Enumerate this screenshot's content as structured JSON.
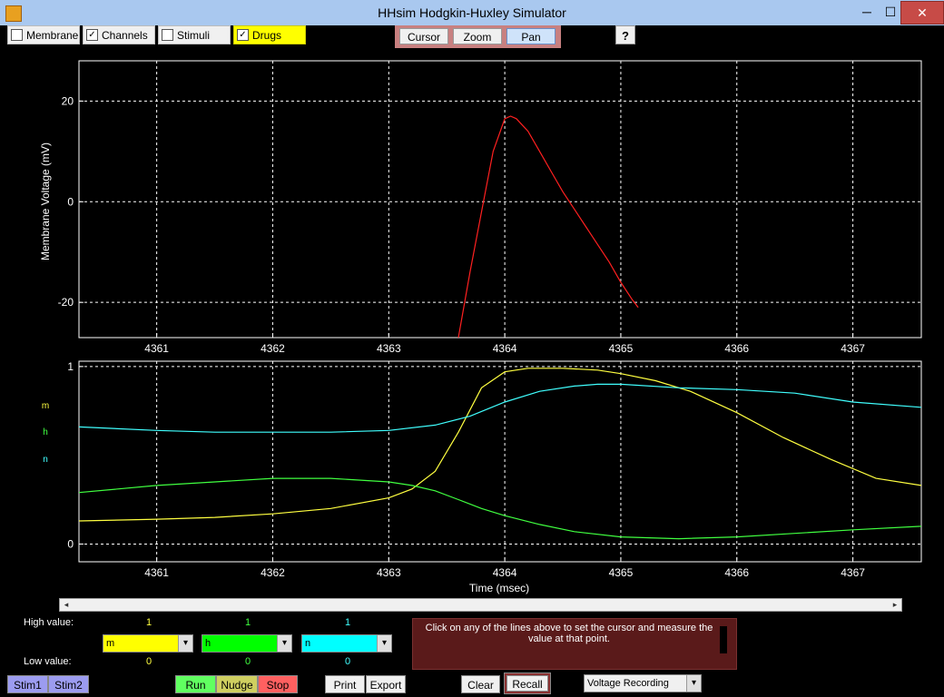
{
  "window": {
    "title": "HHsim Hodgkin-Huxley Simulator",
    "min": "─",
    "max": "☐",
    "close": "✕"
  },
  "toolbar": {
    "checkboxes": [
      {
        "label": "Membrane",
        "checked": false
      },
      {
        "label": "Channels",
        "checked": true
      },
      {
        "label": "Stimuli",
        "checked": false
      },
      {
        "label": "Drugs",
        "checked": true
      }
    ],
    "check_mark": "✓",
    "tools": [
      "Cursor",
      "Zoom",
      "Pan"
    ],
    "help": "?"
  },
  "top_plot": {
    "ylabel": "Membrane Voltage (mV)",
    "yticks": [
      "20",
      "0",
      "-20"
    ],
    "xticks": [
      "4361",
      "4362",
      "4363",
      "4364",
      "4365",
      "4366",
      "4367"
    ],
    "trace_color": "#ff2020"
  },
  "bottom_plot": {
    "xlabel": "Time (msec)",
    "yticks": [
      "1",
      "0"
    ],
    "xticks": [
      "4361",
      "4362",
      "4363",
      "4364",
      "4365",
      "4366",
      "4367"
    ],
    "legend": [
      {
        "label": "m",
        "color": "#ffff40"
      },
      {
        "label": "h",
        "color": "#40ff40"
      },
      {
        "label": "n",
        "color": "#40ffff"
      }
    ]
  },
  "chart_data": [
    {
      "type": "line",
      "title": "",
      "xlabel": "",
      "ylabel": "Membrane Voltage (mV)",
      "xlim": [
        4360.33,
        4367.59
      ],
      "ylim": [
        -27,
        28
      ],
      "grid": true,
      "series": [
        {
          "color": "#ff2020",
          "x": [
            4363.6,
            4363.7,
            4363.8,
            4363.9,
            4364.0,
            4364.05,
            4364.1,
            4364.2,
            4364.3,
            4364.4,
            4364.5,
            4364.6,
            4364.7,
            4364.8,
            4364.9,
            4365.0,
            4365.1,
            4365.15
          ],
          "y": [
            -27,
            -14,
            -2,
            10,
            16.5,
            17,
            16.5,
            14,
            10,
            6,
            2,
            -1.5,
            -5,
            -8.5,
            -12,
            -16,
            -19.5,
            -21
          ]
        }
      ]
    },
    {
      "type": "line",
      "title": "",
      "xlabel": "Time (msec)",
      "ylabel": "",
      "xlim": [
        4360.33,
        4367.59
      ],
      "ylim": [
        -0.1,
        1.03
      ],
      "grid": true,
      "series": [
        {
          "name": "m",
          "color": "#ffff40",
          "x": [
            4360.33,
            4361.0,
            4361.5,
            4362.0,
            4362.5,
            4363.0,
            4363.2,
            4363.4,
            4363.6,
            4363.8,
            4364.0,
            4364.2,
            4364.5,
            4364.8,
            4365.0,
            4365.3,
            4365.6,
            4366.0,
            4366.4,
            4366.8,
            4367.2,
            4367.59
          ],
          "y": [
            0.13,
            0.14,
            0.15,
            0.17,
            0.2,
            0.26,
            0.31,
            0.41,
            0.63,
            0.88,
            0.97,
            0.99,
            0.99,
            0.98,
            0.96,
            0.92,
            0.86,
            0.74,
            0.6,
            0.48,
            0.37,
            0.33
          ]
        },
        {
          "name": "h",
          "color": "#40ff40",
          "x": [
            4360.33,
            4361.0,
            4361.5,
            4362.0,
            4362.5,
            4363.0,
            4363.2,
            4363.4,
            4363.6,
            4363.8,
            4364.0,
            4364.3,
            4364.6,
            4365.0,
            4365.5,
            4366.0,
            4366.5,
            4367.0,
            4367.59
          ],
          "y": [
            0.29,
            0.33,
            0.35,
            0.37,
            0.37,
            0.35,
            0.33,
            0.3,
            0.25,
            0.2,
            0.16,
            0.11,
            0.07,
            0.04,
            0.03,
            0.04,
            0.06,
            0.08,
            0.1
          ]
        },
        {
          "name": "n",
          "color": "#40ffff",
          "x": [
            4360.33,
            4361.0,
            4361.5,
            4362.0,
            4362.5,
            4363.0,
            4363.4,
            4363.7,
            4364.0,
            4364.3,
            4364.6,
            4364.8,
            4365.0,
            4365.5,
            4366.0,
            4366.5,
            4367.0,
            4367.59
          ],
          "y": [
            0.66,
            0.64,
            0.63,
            0.63,
            0.63,
            0.64,
            0.67,
            0.72,
            0.8,
            0.86,
            0.89,
            0.9,
            0.9,
            0.88,
            0.87,
            0.85,
            0.8,
            0.77
          ]
        }
      ]
    }
  ],
  "controls": {
    "scroll_left": "◂",
    "scroll_right": "▸",
    "high_label": "High value:",
    "low_label": "Low value:",
    "selectors": [
      {
        "label": "m",
        "high": "1",
        "low": "0",
        "bg": "#ffff00",
        "value_color": "#ffff40"
      },
      {
        "label": "h",
        "high": "1",
        "low": "0",
        "bg": "#00ff00",
        "value_color": "#40ff40"
      },
      {
        "label": "n",
        "high": "1",
        "low": "0",
        "bg": "#00ffff",
        "value_color": "#40ffff"
      }
    ],
    "dropdown_arrow": "▾",
    "message": "Click on any of the lines above to set the cursor and measure the value at that point.",
    "stim1": "Stim1",
    "stim2": "Stim2",
    "run": "Run",
    "nudge": "Nudge",
    "stop": "Stop",
    "print": "Print",
    "export": "Export",
    "clear": "Clear",
    "recall": "Recall",
    "recording_select": "Voltage Recording"
  }
}
